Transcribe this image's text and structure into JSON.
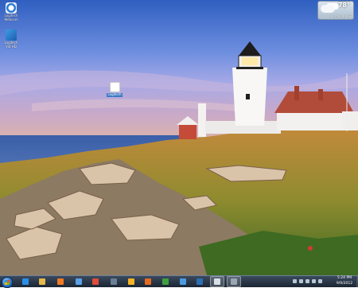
{
  "desktop": {
    "icons": [
      {
        "label": "Logitech Webcam"
      },
      {
        "label": "Logitech Vid HD"
      },
      {
        "label": "Logitech"
      }
    ]
  },
  "weather": {
    "temperature": "78°",
    "city": "Portland, ME"
  },
  "taskbar": {
    "items": [
      {
        "name": "internet-explorer",
        "color": "#2a8fe6"
      },
      {
        "name": "file-explorer",
        "color": "#e6b84a"
      },
      {
        "name": "media-player",
        "color": "#f07a24"
      },
      {
        "name": "logitech-webcam",
        "color": "#5aa0e6"
      },
      {
        "name": "chrome",
        "color": "#e04b3a"
      },
      {
        "name": "remote-desktop",
        "color": "#6a7f96"
      },
      {
        "name": "windows-live",
        "color": "#f6b325"
      },
      {
        "name": "firefox",
        "color": "#e66a1f"
      },
      {
        "name": "windows-flag",
        "color": "#3fa23f"
      },
      {
        "name": "paint",
        "color": "#4c9be0"
      },
      {
        "name": "network",
        "color": "#2d6fb3"
      },
      {
        "name": "explorer-window",
        "color": "#d8dfe7"
      },
      {
        "name": "camera-app",
        "color": "#9aa6b2"
      }
    ],
    "clock": {
      "time": "5:24 PM",
      "date": "9/9/2012"
    }
  }
}
